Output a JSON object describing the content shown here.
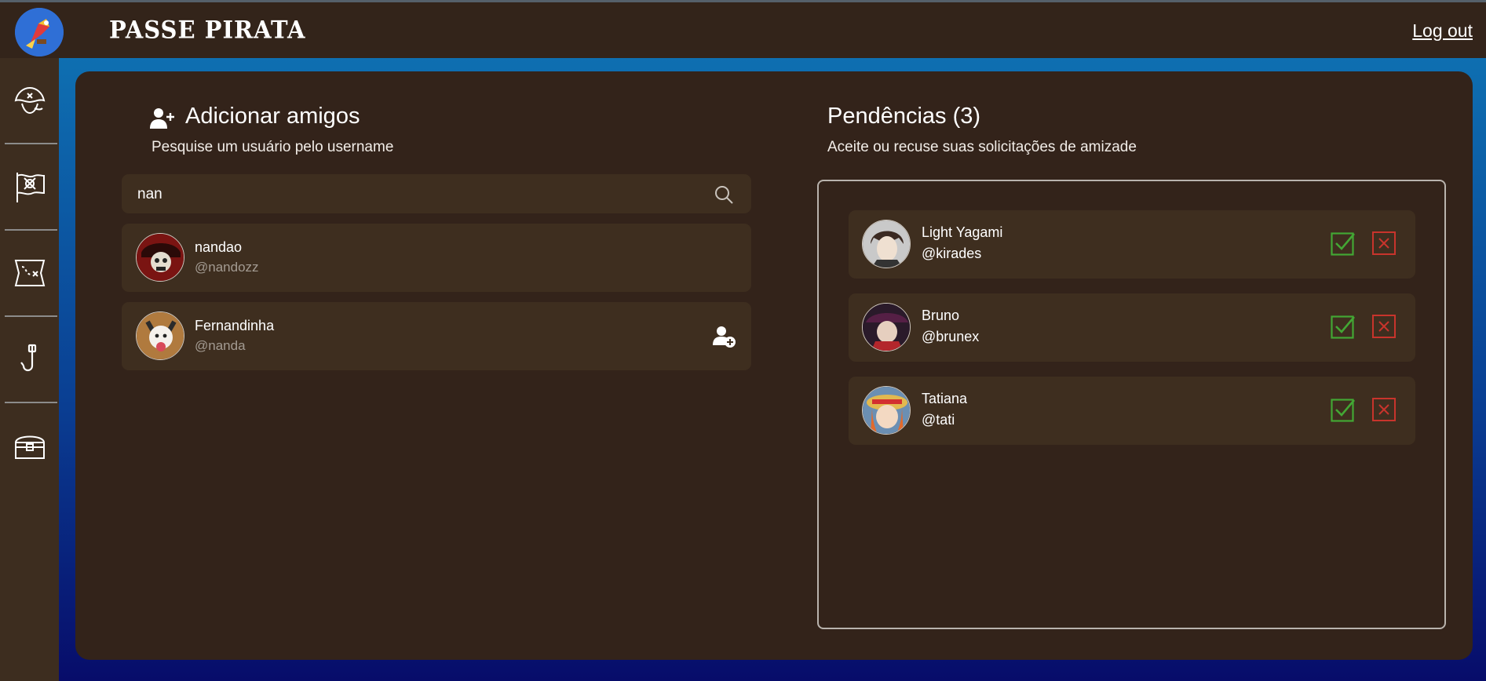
{
  "header": {
    "brand": "PASSE PIRATA",
    "logout_label": "Log out"
  },
  "sidebar": {
    "items": [
      {
        "icon": "pirate-hat-icon"
      },
      {
        "icon": "pirate-flag-icon"
      },
      {
        "icon": "treasure-map-icon"
      },
      {
        "icon": "hook-icon"
      },
      {
        "icon": "treasure-chest-icon"
      }
    ]
  },
  "add_friends": {
    "title": "Adicionar amigos",
    "subtitle": "Pesquise um usuário pelo username",
    "search_value": "nan",
    "results": [
      {
        "name": "nandao",
        "handle": "@nandozz",
        "can_add": false
      },
      {
        "name": "Fernandinha",
        "handle": "@nanda",
        "can_add": true
      }
    ]
  },
  "pending": {
    "title": "Pendências (3)",
    "subtitle": "Aceite ou recuse suas solicitações de amizade",
    "requests": [
      {
        "name": "Light Yagami",
        "handle": "@kirades"
      },
      {
        "name": "Bruno",
        "handle": "@brunex"
      },
      {
        "name": "Tatiana",
        "handle": "@tati"
      }
    ]
  },
  "colors": {
    "accept": "#43a734",
    "reject": "#c8342c",
    "panel": "#33231a",
    "row": "#3e2e1f"
  }
}
